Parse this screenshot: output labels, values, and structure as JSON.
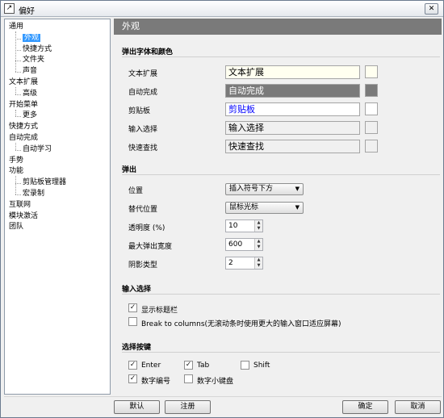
{
  "window": {
    "title": "偏好",
    "close_label": "✕"
  },
  "tree": [
    {
      "label": "通用",
      "level": 0
    },
    {
      "label": "外观",
      "level": 1,
      "selected": true
    },
    {
      "label": "快捷方式",
      "level": 1
    },
    {
      "label": "文件夹",
      "level": 1
    },
    {
      "label": "声音",
      "level": 1
    },
    {
      "label": "文本扩展",
      "level": 0
    },
    {
      "label": "高级",
      "level": 1
    },
    {
      "label": "开始菜单",
      "level": 0
    },
    {
      "label": "更多",
      "level": 1
    },
    {
      "label": "快捷方式",
      "level": 0
    },
    {
      "label": "自动完成",
      "level": 0
    },
    {
      "label": "自动学习",
      "level": 1
    },
    {
      "label": "手势",
      "level": 0
    },
    {
      "label": "功能",
      "level": 0
    },
    {
      "label": "剪贴板管理器",
      "level": 1
    },
    {
      "label": "宏录制",
      "level": 1
    },
    {
      "label": "互联网",
      "level": 0
    },
    {
      "label": "模块激活",
      "level": 0
    },
    {
      "label": "团队",
      "level": 0
    }
  ],
  "header": {
    "title": "外观"
  },
  "fonts_section": {
    "title": "弹出字体和颜色",
    "rows": [
      {
        "label": "文本扩展",
        "value": "文本扩展",
        "bg": "#fffff0",
        "fg": "#000000"
      },
      {
        "label": "自动完成",
        "value": "自动完成",
        "bg": "#7a7a7a",
        "fg": "#ffffff"
      },
      {
        "label": "剪贴板",
        "value": "剪贴板",
        "bg": "#ffffff",
        "fg": "#0000ff"
      },
      {
        "label": "输入选择",
        "value": "输入选择",
        "bg": "#f0f0f0",
        "fg": "#000000"
      },
      {
        "label": "快速查找",
        "value": "快速查找",
        "bg": "#f0f0f0",
        "fg": "#000000"
      }
    ]
  },
  "popup_section": {
    "title": "弹出",
    "position_label": "位置",
    "position_value": "插入符号下方",
    "alt_position_label": "替代位置",
    "alt_position_value": "鼠标光标",
    "transparency_label": "透明度 (%)",
    "transparency_value": "10",
    "max_width_label": "最大弹出宽度",
    "max_width_value": "600",
    "shadow_label": "阴影类型",
    "shadow_value": "2"
  },
  "input_section": {
    "title": "输入选择",
    "show_title_label": "显示标题栏",
    "show_title_checked": true,
    "break_label": "Break to columns(无滚动条时使用更大的输入窗口适应屏幕)",
    "break_checked": false
  },
  "keys_section": {
    "title": "选择按键",
    "keys": [
      {
        "label": "Enter",
        "checked": true
      },
      {
        "label": "Tab",
        "checked": true
      },
      {
        "label": "Shift",
        "checked": false
      },
      {
        "label": "数字编号",
        "checked": true
      },
      {
        "label": "数字小键盘",
        "checked": false
      }
    ]
  },
  "footer": {
    "default_label": "默认",
    "register_label": "注册",
    "ok_label": "确定",
    "cancel_label": "取消"
  },
  "check_glyph": "✓"
}
